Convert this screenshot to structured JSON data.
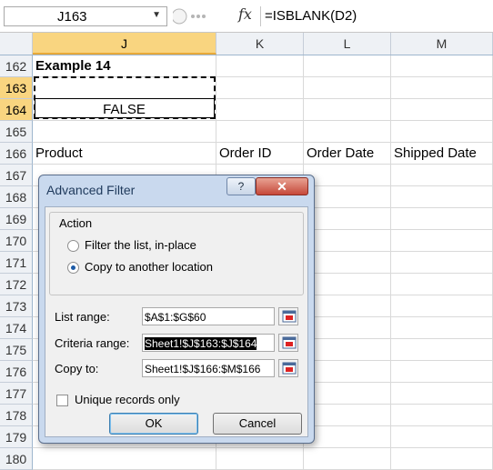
{
  "formula_bar": {
    "name_box": "J163",
    "fx_label": "fx",
    "formula": "=ISBLANK(D2)"
  },
  "columns": [
    {
      "label": "J",
      "selected": true
    },
    {
      "label": "K",
      "selected": false
    },
    {
      "label": "L",
      "selected": false
    },
    {
      "label": "M",
      "selected": false
    }
  ],
  "rows": [
    {
      "num": "162",
      "selected": false,
      "cells": [
        "Example 14",
        "",
        "",
        ""
      ]
    },
    {
      "num": "163",
      "selected": true,
      "cells": [
        "",
        "",
        "",
        ""
      ]
    },
    {
      "num": "164",
      "selected": true,
      "cells": [
        "FALSE",
        "",
        "",
        ""
      ]
    },
    {
      "num": "165",
      "selected": false,
      "cells": [
        "",
        "",
        "",
        ""
      ]
    },
    {
      "num": "166",
      "selected": false,
      "cells": [
        "Product",
        "Order ID",
        "Order Date",
        "Shipped Date"
      ]
    },
    {
      "num": "167",
      "selected": false,
      "cells": [
        "",
        "",
        "",
        ""
      ]
    },
    {
      "num": "168",
      "selected": false,
      "cells": [
        "",
        "",
        "",
        ""
      ]
    },
    {
      "num": "169",
      "selected": false,
      "cells": [
        "",
        "",
        "",
        ""
      ]
    },
    {
      "num": "170",
      "selected": false,
      "cells": [
        "",
        "",
        "",
        ""
      ]
    },
    {
      "num": "171",
      "selected": false,
      "cells": [
        "",
        "",
        "",
        ""
      ]
    },
    {
      "num": "172",
      "selected": false,
      "cells": [
        "",
        "",
        "",
        ""
      ]
    },
    {
      "num": "173",
      "selected": false,
      "cells": [
        "",
        "",
        "",
        ""
      ]
    },
    {
      "num": "174",
      "selected": false,
      "cells": [
        "",
        "",
        "",
        ""
      ]
    },
    {
      "num": "175",
      "selected": false,
      "cells": [
        "",
        "",
        "",
        ""
      ]
    },
    {
      "num": "176",
      "selected": false,
      "cells": [
        "",
        "",
        "",
        ""
      ]
    },
    {
      "num": "177",
      "selected": false,
      "cells": [
        "",
        "",
        "",
        ""
      ]
    },
    {
      "num": "178",
      "selected": false,
      "cells": [
        "",
        "",
        "",
        ""
      ]
    },
    {
      "num": "179",
      "selected": false,
      "cells": [
        "",
        "",
        "",
        ""
      ]
    },
    {
      "num": "180",
      "selected": false,
      "cells": [
        "",
        "",
        "",
        ""
      ]
    }
  ],
  "dialog": {
    "title": "Advanced Filter",
    "help": "?",
    "close": "✕",
    "action_label": "Action",
    "radio_filter_in_place": "Filter the list, in-place",
    "radio_copy_to": "Copy to another location",
    "list_range_label": "List range:",
    "list_range_value": "$A$1:$G$60",
    "criteria_range_label": "Criteria range:",
    "criteria_range_value": "Sheet1!$J$163:$J$164",
    "copy_to_label": "Copy to:",
    "copy_to_value": "Sheet1!$J$166:$M$166",
    "unique_label": "Unique records only",
    "unique_checked": false,
    "ok_label": "OK",
    "cancel_label": "Cancel"
  },
  "colors": {
    "selected_header": "#f9d580",
    "dialog_frame": "#c9d9ee",
    "close_button": "#c6483a",
    "criteria_highlight": "#000000"
  }
}
